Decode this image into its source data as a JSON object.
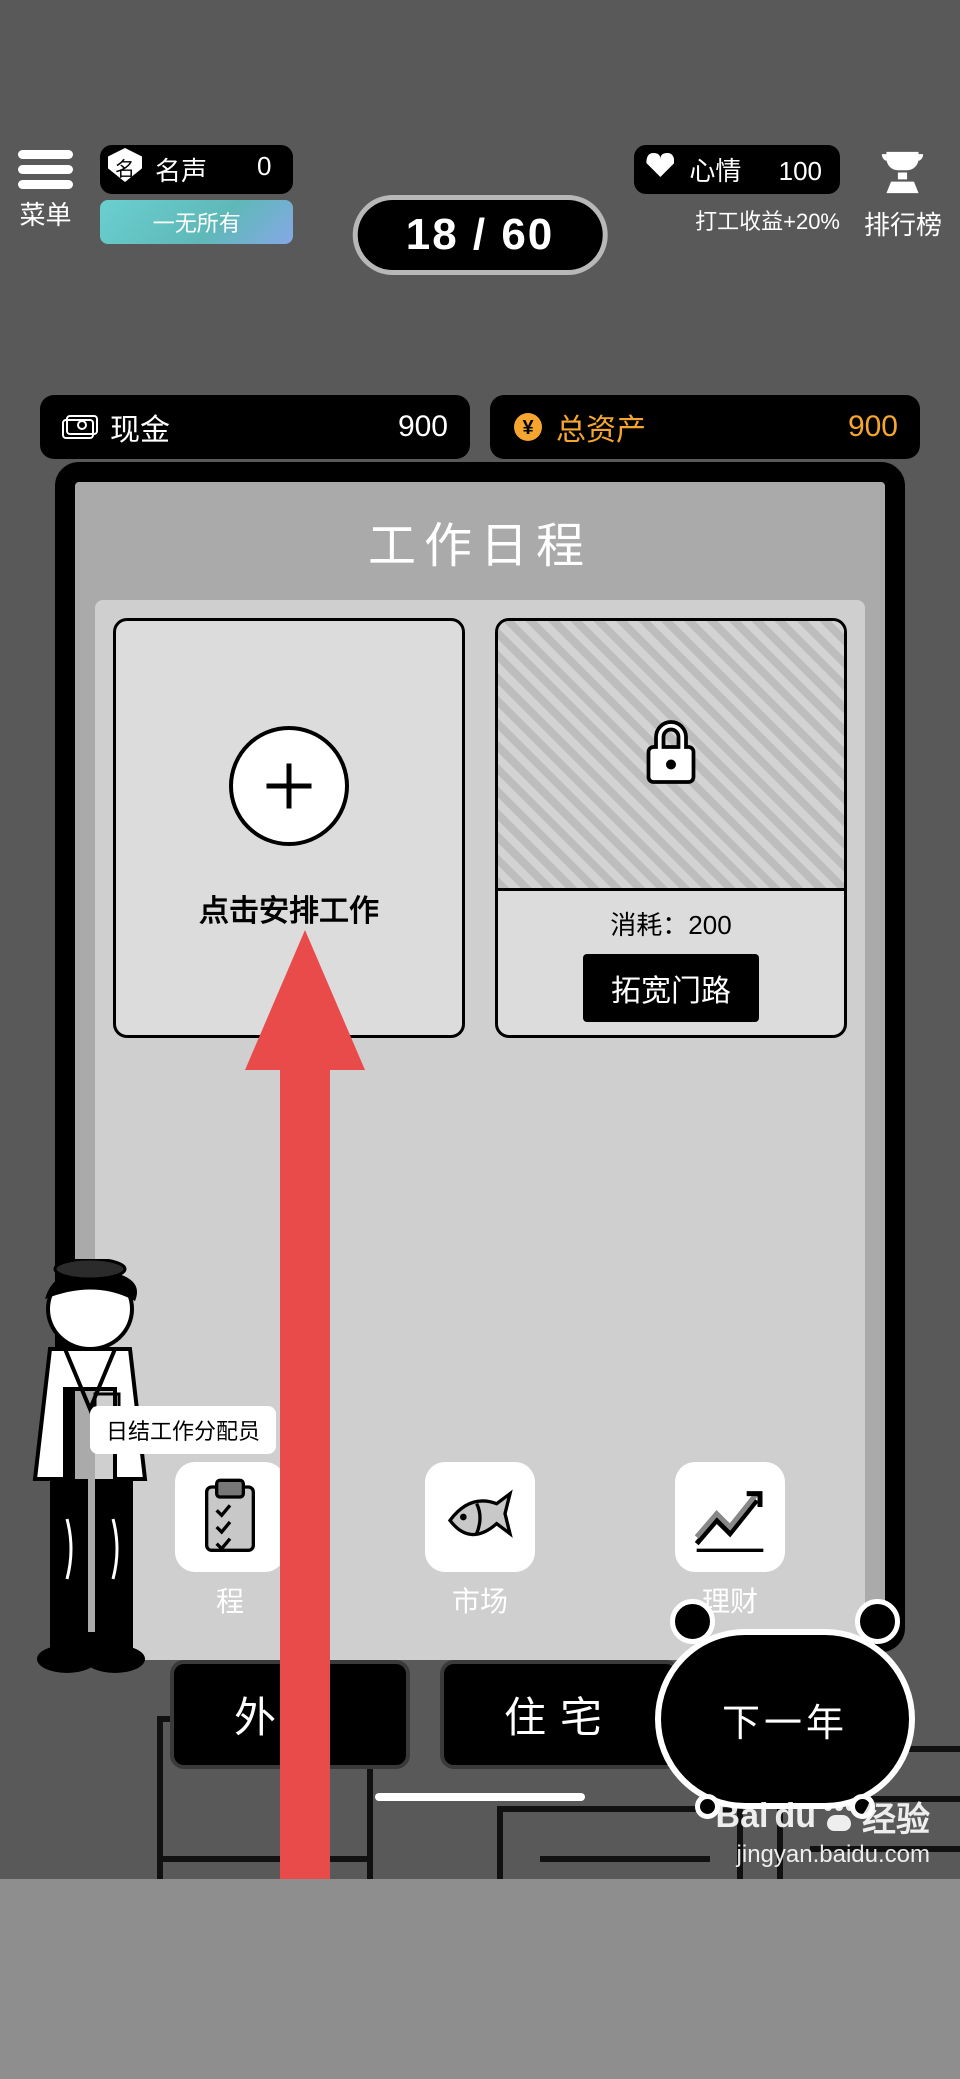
{
  "hud": {
    "menu_label": "菜单",
    "fame_label": "名声",
    "fame_value": "0",
    "fame_tag": "一无所有",
    "mood_label": "心情",
    "mood_value": "100",
    "mood_buff": "打工收益+20%",
    "rank_label": "排行榜",
    "age": "18 / 60"
  },
  "resources": {
    "cash_label": "现金",
    "cash_value": "900",
    "assets_label": "总资产",
    "assets_value": "900"
  },
  "panel": {
    "title": "工作日程",
    "add_card_text": "点击安排工作",
    "locked_cost": "消耗：200",
    "locked_button": "拓宽门路",
    "tabs": {
      "schedule": "程",
      "market": "市场",
      "finance": "理财"
    }
  },
  "npc_tag": "日结工作分配员",
  "bottom": {
    "go_out": "外出",
    "home": "住宅",
    "next_year": "下一年"
  },
  "watermark": {
    "brand": "Baidu 经验",
    "url": "jingyan.baidu.com"
  }
}
